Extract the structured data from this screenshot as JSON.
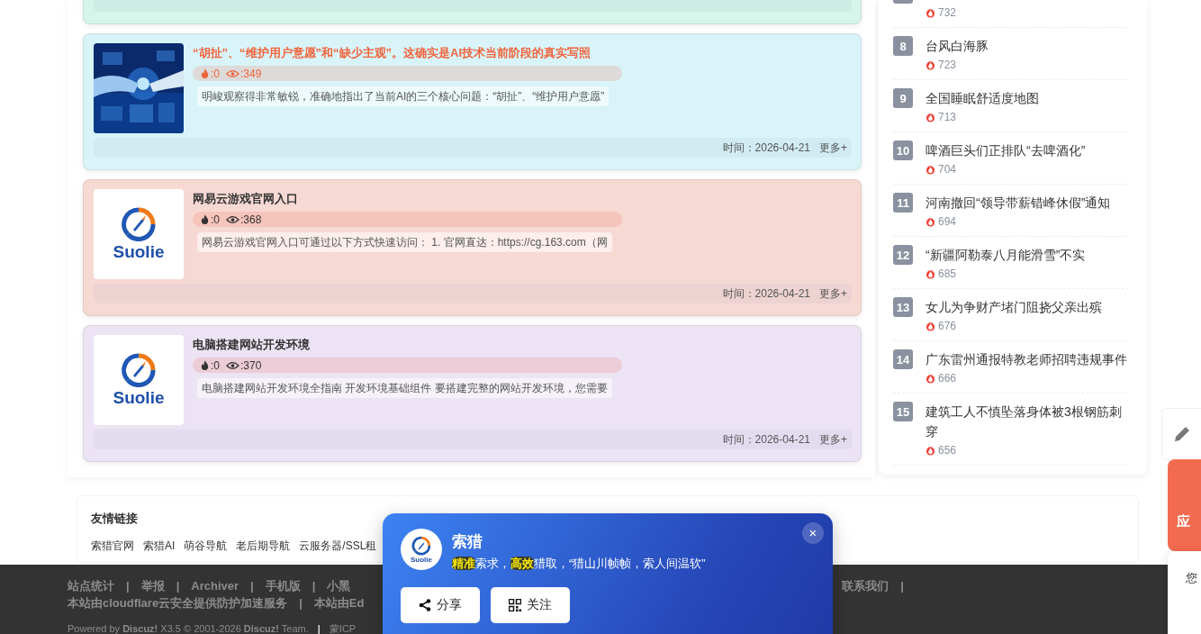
{
  "articles": [
    {
      "color": "#d6f5ea"
    },
    {
      "color": "#d9f4f8",
      "kind": "picture",
      "title": "“胡扯”、“维护用户意愿”和“缺少主观”。这确实是AI技术当前阶段的真实写照",
      "highlighted": true,
      "likes": ":0",
      "views": ":349",
      "excerpt": "明峻观察得非常敏锐，准确地指出了当前AI的三个核心问题：“胡扯”、“维护用户意愿”",
      "date": "时间：2026-04-21",
      "more": "更多+"
    },
    {
      "color": "#f7d9d4",
      "kind": "logo",
      "logo_text": "Suolie",
      "title": "网易云游戏官网入口",
      "highlighted": false,
      "likes": ":0",
      "views": ":368",
      "excerpt": "网易云游戏官网入口可通过以下方式快速访问： 1. 官网直达：https://cg.163.com（网",
      "date": "时间：2026-04-21",
      "more": "更多+"
    },
    {
      "color": "#ece3f4",
      "kind": "logo",
      "logo_text": "Suolie",
      "title": "电脑搭建网站开发环境",
      "highlighted": false,
      "likes": ":0",
      "views": ":370",
      "excerpt": "电脑搭建网站开发环境全指南 开发环境基础组件 要搭建完整的网站开发环境，您需要",
      "date": "时间：2026-04-21",
      "more": "更多+"
    }
  ],
  "hot_list": [
    {
      "heat": "732"
    },
    {
      "rank": "8",
      "title": "台风白海豚",
      "heat": "723"
    },
    {
      "rank": "9",
      "title": "全国睡眠舒适度地图",
      "heat": "713"
    },
    {
      "rank": "10",
      "title": "啤酒巨头们正排队“去啤酒化”",
      "heat": "704"
    },
    {
      "rank": "11",
      "title": "河南撤回“领导带薪错峰休假”通知",
      "heat": "694"
    },
    {
      "rank": "12",
      "title": "“新疆阿勒泰八月能滑雪”不实",
      "heat": "685"
    },
    {
      "rank": "13",
      "title": "女儿为争财产堵门阻挠父亲出殡",
      "heat": "676"
    },
    {
      "rank": "14",
      "title": "广东雷州通报特教老师招聘违规事件",
      "heat": "666"
    },
    {
      "rank": "15",
      "title": "建筑工人不慎坠落身体被3根钢筋刺穿",
      "heat": "656"
    }
  ],
  "friend_links": {
    "title": "友情链接",
    "links": [
      "索猎官网",
      "索猎AI",
      "萌谷导航",
      "老后期导航",
      "云服务器/SSL租"
    ]
  },
  "footer": {
    "line_1": [
      "站点统计",
      "|",
      "举报",
      "|",
      "Archiver",
      "|",
      "手机版",
      "|",
      "小黑"
    ],
    "line_1_right": [
      "联系我们",
      "|"
    ],
    "line_2": [
      "本站由cloudflare云安全提供防护加速服务",
      "|",
      "本站由Ed"
    ],
    "line_3": [
      "Powered by **Discuz!** X3.5 © 2001-2026 **Discuz!** Team.",
      "|",
      "蒙ICP"
    ]
  },
  "popup": {
    "logo_text": "Suolie",
    "title": "索猎",
    "slogan": [
      {
        "text": "精准",
        "highlight": true
      },
      {
        "text": "索求，",
        "highlight": false
      },
      {
        "text": "高效",
        "highlight": true
      },
      {
        "text": "猎取，“猎山川帧帧，索人间温软”",
        "highlight": false
      }
    ],
    "close": "×",
    "buttons": [
      {
        "kind": "share",
        "label": "分享"
      },
      {
        "kind": "qr",
        "label": "关注"
      }
    ]
  },
  "side_widgets": {
    "orange_label": "应",
    "panel_label": "您"
  }
}
